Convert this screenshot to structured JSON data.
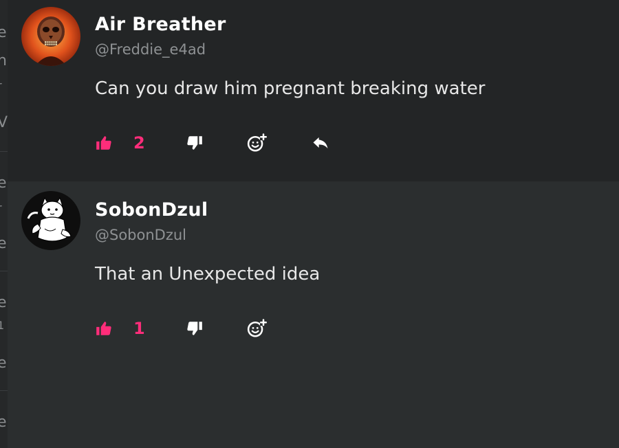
{
  "colors": {
    "accent_like": "#ff2d7a",
    "background_top": "#232526",
    "background_bottom": "#2b2e2f",
    "text_primary": "#ffffff",
    "text_secondary": "#8e9193"
  },
  "left_strip": {
    "fragments": [
      "e",
      "n",
      "r",
      "V",
      "e",
      "r",
      "e",
      "e",
      "1",
      "e",
      "e"
    ]
  },
  "comments": [
    {
      "username": "Air Breather",
      "handle": "@Freddie_e4ad",
      "text": "Can you draw him pregnant breaking water",
      "likes": "2",
      "avatar": "skull-avatar",
      "actions": [
        "like-icon",
        "dislike-icon",
        "add-emoji-icon",
        "reply-icon"
      ]
    },
    {
      "username": "SobonDzul",
      "handle": "@SobonDzul",
      "text": "That an Unexpected idea",
      "likes": "1",
      "avatar": "cartoon-cat-avatar",
      "actions": [
        "like-icon",
        "dislike-icon",
        "add-emoji-icon"
      ]
    }
  ]
}
